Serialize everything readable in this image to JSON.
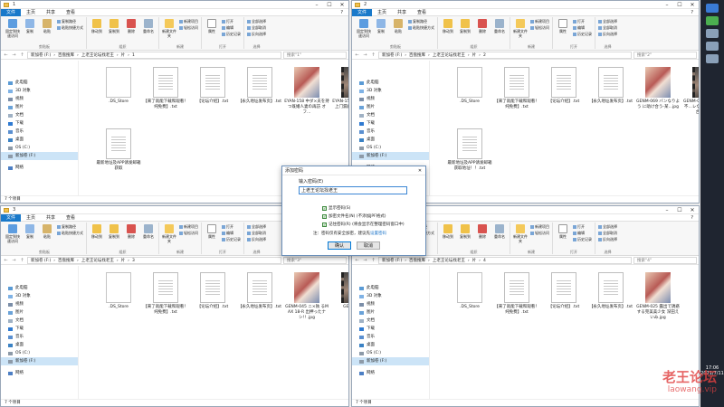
{
  "menu": {
    "file": "文件",
    "home": "主页",
    "share": "共享",
    "view": "查看"
  },
  "ribbon": {
    "pin": "固定到快速访问",
    "copy": "复制",
    "paste": "粘贴",
    "copy_path": "复制路径",
    "paste_shortcut": "粘贴快捷方式",
    "move_to": "移动到",
    "copy_to": "复制到",
    "delete": "删除",
    "rename": "重命名",
    "new_folder": "新建文件夹",
    "new_item": "新建项目",
    "easy_access": "轻松访问",
    "properties": "属性",
    "open": "打开",
    "edit": "编辑",
    "history": "历史记录",
    "select_all": "全部选择",
    "select_none": "全部取消",
    "invert": "反向选择",
    "g_clipboard": "剪贴板",
    "g_organize": "组织",
    "g_new": "新建",
    "g_open": "打开",
    "g_select": "选择"
  },
  "nav": {
    "pc": "此电脑",
    "obj3d": "3D 对象",
    "video": "视频",
    "pics": "图片",
    "docs": "文档",
    "dl": "下载",
    "music": "音乐",
    "desktop": "桌面",
    "osc": "OS (C:)",
    "newvol": "新加卷 (F:)",
    "network": "网络",
    "quick": "快速访问"
  },
  "windows": [
    {
      "path": [
        "新加卷 (F:)",
        "百盘搜库",
        "上老王论坛找老王",
        "片",
        "1"
      ],
      "search": "搜索\"1\"",
      "status": "7 个项目",
      "files": [
        {
          "name": ".DS_Store",
          "kind": "blank"
        },
        {
          "name": "【来了就能下载和观看！纯免费】.txt",
          "kind": "doc"
        },
        {
          "name": "【论坛介绍】.txt",
          "kind": "doc"
        },
        {
          "name": "【永久地址发布页】.txt",
          "kind": "doc"
        },
        {
          "name": "EYAN-158 中ダ×夫を持つ既婚人妻の再訪 オフ…",
          "kind": "pic"
        },
        {
          "name": "EYAN-158-京险 繼續見上门漏斜 老司来店链接…",
          "kind": "vid"
        },
        {
          "name": "最新地址及APP请发邮箱获取",
          "kind": "doc"
        }
      ]
    },
    {
      "path": [
        "新加卷 (F:)",
        "百盘搜库",
        "上老王论坛找老王",
        "片",
        "2"
      ],
      "search": "搜索\"2\"",
      "status": "7 个项目",
      "files": [
        {
          "name": ".DS_Store",
          "kind": "blank"
        },
        {
          "name": "【来了就能下载和观看！纯免费】.txt",
          "kind": "doc"
        },
        {
          "name": "【论坛介绍】.txt",
          "kind": "doc"
        },
        {
          "name": "【永久地址发布页】.txt",
          "kind": "doc"
        },
        {
          "name": "GENM-069 バンなりよう に助け合う-某…jpg",
          "kind": "pic"
        },
        {
          "name": "GENM-069-用然会死在不…レないよう に助け合う.mp4",
          "kind": "vid"
        },
        {
          "name": "最新地址及APP请发邮箱获取地址！！.txt",
          "kind": "doc"
        }
      ]
    },
    {
      "path": [
        "新加卷 (F:)",
        "百盘搜库",
        "上老王论坛找老王",
        "片",
        "3"
      ],
      "search": "搜索\"3\"",
      "status": "7 个项目",
      "files": [
        {
          "name": ".DS_Store",
          "kind": "blank"
        },
        {
          "name": "【来了就能下载和观看！纯免费】.txt",
          "kind": "doc"
        },
        {
          "name": "【论坛介绍】.txt",
          "kind": "doc"
        },
        {
          "name": "【永久地址发布页】.txt",
          "kind": "doc"
        },
        {
          "name": "GENM-045 ニ×執 るMAX 18-R 出押ったナシ!! .jpg",
          "kind": "pic"
        },
        {
          "name": "GENM-045",
          "kind": "vid"
        }
      ]
    },
    {
      "path": [
        "新加卷 (F:)",
        "百盘搜库",
        "上老王论坛找老王",
        "片",
        "4"
      ],
      "search": "搜索\"4\"",
      "status": "7 个项目",
      "files": [
        {
          "name": ".DS_Store",
          "kind": "blank"
        },
        {
          "name": "【来了就能下载和观看！纯免费】.txt",
          "kind": "doc"
        },
        {
          "name": "【论坛介绍】.txt",
          "kind": "doc"
        },
        {
          "name": "【永久地址发布页】.txt",
          "kind": "doc"
        },
        {
          "name": "GENM-025 露出で誘惑する完美美少女 深田えいみ.jpg",
          "kind": "pic"
        }
      ]
    }
  ],
  "dialog": {
    "title": "添加密码",
    "label": "输入密码(E)",
    "value": "上老王论坛找老王",
    "opt1": "显示密码(S)",
    "opt2": "加密文件名(N) (不添加JPF格式)",
    "opt3": "记住密码(R) (将会显示在整理密码窗口中)",
    "note_prefix": "注：密码仅有安全加密，建议先",
    "note_link": "设置密码",
    "ok": "确认",
    "cancel": "取消"
  },
  "clock": {
    "time": "17:06",
    "date": "2021/7/11"
  },
  "watermark": {
    "text": "老王论坛",
    "url": "laowang.vip"
  }
}
